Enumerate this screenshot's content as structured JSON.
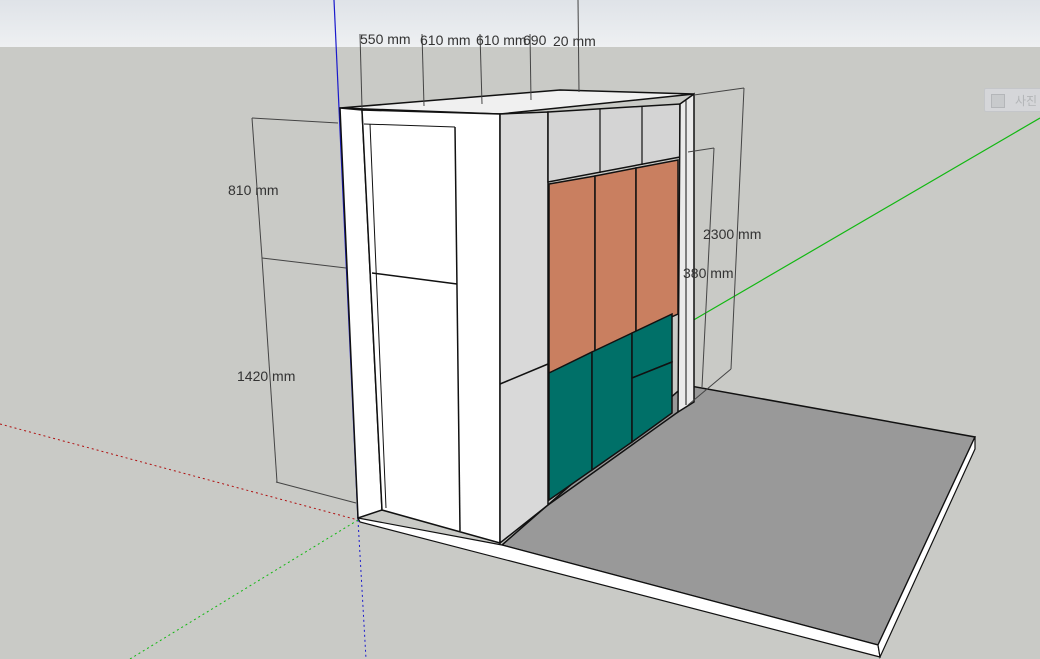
{
  "scene_tab": {
    "label": "사진",
    "icon": "scene-icon"
  },
  "dimensions": {
    "top_1": "550 mm",
    "top_2": "610 mm",
    "top_3": "610 mm",
    "top_4": "690",
    "top_5": "20 mm",
    "left_upper": "810 mm",
    "left_lower": "1420 mm",
    "right_total": "2300 mm",
    "right_partial": "380 mm"
  },
  "colors": {
    "upper_doors": "#c97f60",
    "lower_doors": "#007068",
    "floor": "#999999",
    "axis_red": "#b01010",
    "axis_green": "#12b812",
    "axis_blue": "#1a1acc"
  }
}
